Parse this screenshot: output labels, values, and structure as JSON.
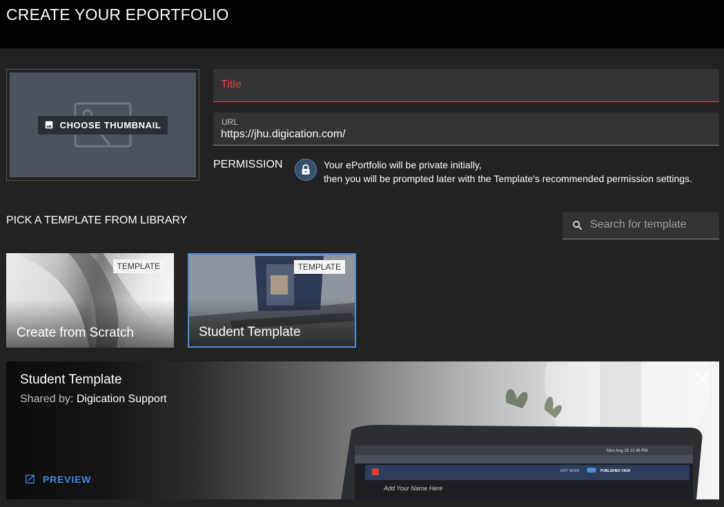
{
  "header": {
    "title": "CREATE YOUR EPORTFOLIO"
  },
  "thumbnail": {
    "button_label": "CHOOSE THUMBNAIL",
    "icon": "image-icon"
  },
  "title_field": {
    "placeholder": "Title",
    "value": ""
  },
  "url_field": {
    "label": "URL",
    "value": "https://jhu.digication.com/"
  },
  "permission": {
    "label": "PERMISSION",
    "icon": "lock-icon",
    "line1": "Your ePortfolio will be private initially,",
    "line2": "then you will be prompted later with the Template's recommended permission settings."
  },
  "library": {
    "label": "PICK A TEMPLATE FROM LIBRARY",
    "search_placeholder": "Search for template",
    "templates": [
      {
        "tag": "TEMPLATE",
        "title": "Create from Scratch",
        "selected": false
      },
      {
        "tag": "TEMPLATE",
        "title": "Student Template",
        "selected": true
      }
    ]
  },
  "preview": {
    "title": "Student Template",
    "shared_label": "Shared by:",
    "shared_name": "Digication Support",
    "preview_label": "PREVIEW",
    "screen_date": "Mon Aug 28 12:48 PM",
    "screen_mode_edit": "EDIT MODE",
    "screen_mode_published": "PUBLISHED VIEW",
    "screen_name_placeholder": "Add Your Name Here"
  },
  "colors": {
    "accent": "#4a8fe0",
    "error": "#e0453f",
    "link": "#3d8be8",
    "background": "#222222",
    "header": "#000000"
  }
}
